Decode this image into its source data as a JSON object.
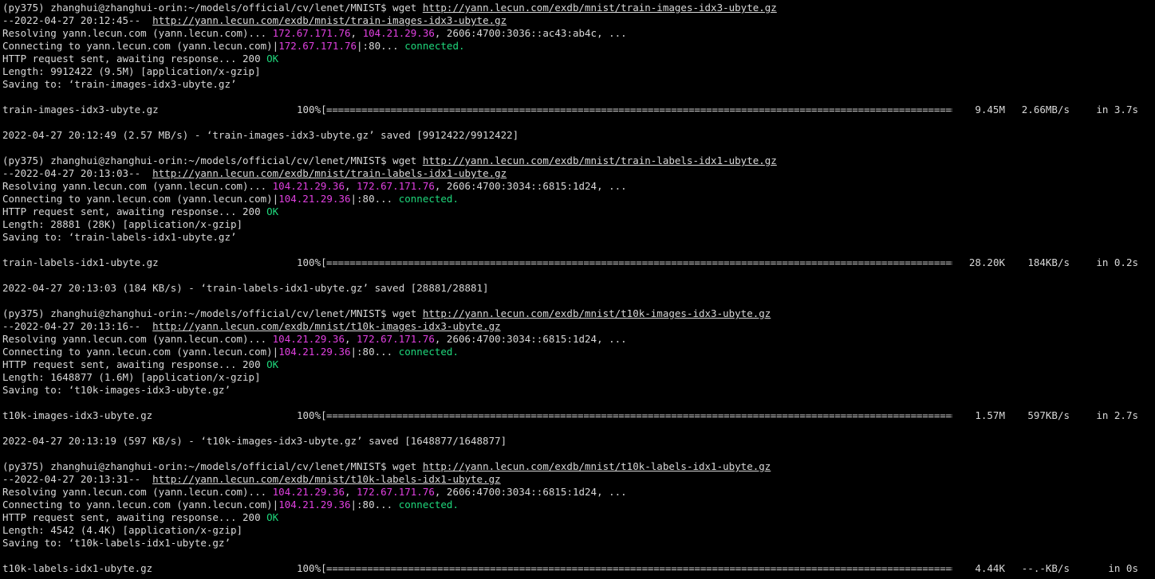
{
  "blocks": [
    {
      "prompt": "(py375) zhanghui@zhanghui-orin:~/models/official/cv/lenet/MNIST$ ",
      "command": "wget ",
      "url": "http://yann.lecun.com/exdb/mnist/train-images-idx3-ubyte.gz",
      "timestamp_line": "--2022-04-27 20:12:45--  ",
      "resolving_prefix": "Resolving yann.lecun.com (yann.lecun.com)... ",
      "ip1": "172.67.171.76",
      "ip2": "104.21.29.36",
      "ipv6": ", 2606:4700:3036::ac43:ab4c, ...",
      "connecting_prefix": "Connecting to yann.lecun.com (yann.lecun.com)|",
      "connect_ip": "172.67.171.76",
      "connect_port": "|:80... ",
      "connected": "connected.",
      "http_line": "HTTP request sent, awaiting response... 200 ",
      "ok": "OK",
      "length": "Length: 9912422 (9.5M) [application/x-gzip]",
      "saving": "Saving to: ‘train-images-idx3-ubyte.gz’",
      "progress": {
        "file": "train-images-idx3-ubyte.gz",
        "percent": "100%[",
        "bar": "===================================================================================================================================================>]",
        "size": "9.45M",
        "rate": "2.66MB/s",
        "eta": "in 3.7s"
      },
      "saved": "2022-04-27 20:12:49 (2.57 MB/s) - ‘train-images-idx3-ubyte.gz’ saved [9912422/9912422]"
    },
    {
      "prompt": "(py375) zhanghui@zhanghui-orin:~/models/official/cv/lenet/MNIST$ ",
      "command": "wget ",
      "url": "http://yann.lecun.com/exdb/mnist/train-labels-idx1-ubyte.gz",
      "timestamp_line": "--2022-04-27 20:13:03--  ",
      "resolving_prefix": "Resolving yann.lecun.com (yann.lecun.com)... ",
      "ip1": "104.21.29.36",
      "ip2": "172.67.171.76",
      "ipv6": ", 2606:4700:3034::6815:1d24, ...",
      "connecting_prefix": "Connecting to yann.lecun.com (yann.lecun.com)|",
      "connect_ip": "104.21.29.36",
      "connect_port": "|:80... ",
      "connected": "connected.",
      "http_line": "HTTP request sent, awaiting response... 200 ",
      "ok": "OK",
      "length": "Length: 28881 (28K) [application/x-gzip]",
      "saving": "Saving to: ‘train-labels-idx1-ubyte.gz’",
      "progress": {
        "file": "train-labels-idx1-ubyte.gz",
        "percent": "100%[",
        "bar": "===================================================================================================================================================>]",
        "size": "28.20K",
        "rate": "184KB/s",
        "eta": "in 0.2s"
      },
      "saved": "2022-04-27 20:13:03 (184 KB/s) - ‘train-labels-idx1-ubyte.gz’ saved [28881/28881]"
    },
    {
      "prompt": "(py375) zhanghui@zhanghui-orin:~/models/official/cv/lenet/MNIST$ ",
      "command": "wget ",
      "url": "http://yann.lecun.com/exdb/mnist/t10k-images-idx3-ubyte.gz",
      "timestamp_line": "--2022-04-27 20:13:16--  ",
      "resolving_prefix": "Resolving yann.lecun.com (yann.lecun.com)... ",
      "ip1": "104.21.29.36",
      "ip2": "172.67.171.76",
      "ipv6": ", 2606:4700:3034::6815:1d24, ...",
      "connecting_prefix": "Connecting to yann.lecun.com (yann.lecun.com)|",
      "connect_ip": "104.21.29.36",
      "connect_port": "|:80... ",
      "connected": "connected.",
      "http_line": "HTTP request sent, awaiting response... 200 ",
      "ok": "OK",
      "length": "Length: 1648877 (1.6M) [application/x-gzip]",
      "saving": "Saving to: ‘t10k-images-idx3-ubyte.gz’",
      "progress": {
        "file": "t10k-images-idx3-ubyte.gz",
        "percent": "100%[",
        "bar": "===================================================================================================================================================>]",
        "size": "1.57M",
        "rate": "597KB/s",
        "eta": "in 2.7s"
      },
      "saved": "2022-04-27 20:13:19 (597 KB/s) - ‘t10k-images-idx3-ubyte.gz’ saved [1648877/1648877]"
    },
    {
      "prompt": "(py375) zhanghui@zhanghui-orin:~/models/official/cv/lenet/MNIST$ ",
      "command": "wget ",
      "url": "http://yann.lecun.com/exdb/mnist/t10k-labels-idx1-ubyte.gz",
      "timestamp_line": "--2022-04-27 20:13:31--  ",
      "resolving_prefix": "Resolving yann.lecun.com (yann.lecun.com)... ",
      "ip1": "104.21.29.36",
      "ip2": "172.67.171.76",
      "ipv6": ", 2606:4700:3034::6815:1d24, ...",
      "connecting_prefix": "Connecting to yann.lecun.com (yann.lecun.com)|",
      "connect_ip": "104.21.29.36",
      "connect_port": "|:80... ",
      "connected": "connected.",
      "http_line": "HTTP request sent, awaiting response... 200 ",
      "ok": "OK",
      "length": "Length: 4542 (4.4K) [application/x-gzip]",
      "saving": "Saving to: ‘t10k-labels-idx1-ubyte.gz’",
      "progress": {
        "file": "t10k-labels-idx1-ubyte.gz",
        "percent": "100%[",
        "bar": "===================================================================================================================================================>]",
        "size": "4.44K",
        "rate": "--.-KB/s",
        "eta": "in 0s"
      },
      "saved": ""
    }
  ],
  "colors": {
    "background": "#000000",
    "text": "#d8d8d8",
    "ip": "#e040e0",
    "ok": "#1fd87c"
  }
}
